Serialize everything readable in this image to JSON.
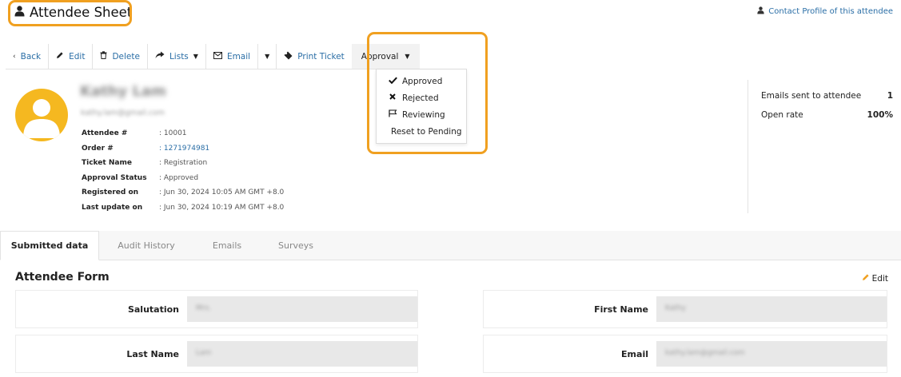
{
  "header": {
    "title": "Attendee Sheet",
    "contact_link": "Contact Profile of this attendee"
  },
  "toolbar": {
    "back": "Back",
    "edit": "Edit",
    "delete": "Delete",
    "lists": "Lists",
    "email": "Email",
    "print_ticket": "Print Ticket",
    "approval": "Approval"
  },
  "approval_menu": {
    "items": [
      "Approved",
      "Rejected",
      "Reviewing",
      "Reset to Pending"
    ]
  },
  "attendee": {
    "name": "Kathy Lam",
    "email": "kathy.lam@gmail.com",
    "details": [
      {
        "label": "Attendee #",
        "value": ": 10001"
      },
      {
        "label": "Order #",
        "value": ": 1271974981"
      },
      {
        "label": "Ticket Name",
        "value": ": Registration"
      },
      {
        "label": "Approval Status",
        "value": ": Approved"
      },
      {
        "label": "Registered on",
        "value": ": Jun 30, 2024 10:05 AM GMT +8.0"
      },
      {
        "label": "Last update on",
        "value": ": Jun 30, 2024 10:19 AM GMT +8.0"
      }
    ]
  },
  "stats": [
    {
      "label": "Emails sent to attendee",
      "value": "1"
    },
    {
      "label": "Open rate",
      "value": "100%"
    }
  ],
  "tabs": [
    "Submitted data",
    "Audit History",
    "Emails",
    "Surveys"
  ],
  "form": {
    "title": "Attendee Form",
    "edit": "Edit",
    "fields": [
      {
        "label": "Salutation",
        "value": "Mrs."
      },
      {
        "label": "First Name",
        "value": "Kathy"
      },
      {
        "label": "Last Name",
        "value": "Lam"
      },
      {
        "label": "Email",
        "value": "kathy.lam@gmail.com"
      }
    ]
  },
  "colors": {
    "accent_highlight": "#f0a020",
    "link": "#2a6ea6",
    "avatar": "#f5b820"
  }
}
